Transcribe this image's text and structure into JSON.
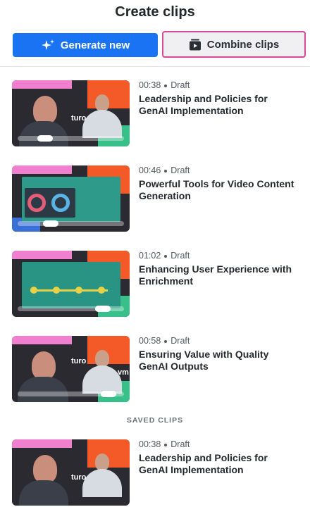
{
  "header": {
    "title": "Create clips"
  },
  "actions": {
    "generate_label": "Generate new",
    "combine_label": "Combine clips"
  },
  "clips": [
    {
      "duration": "00:38",
      "status": "Draft",
      "title": "Leadership and Policies for GenAI Implementation",
      "progress": 0.28
    },
    {
      "duration": "00:46",
      "status": "Draft",
      "title": "Powerful Tools for Video Content Generation",
      "progress": 0.35
    },
    {
      "duration": "01:02",
      "status": "Draft",
      "title": "Enhancing User Experience with Enrichment",
      "progress": 0.85
    },
    {
      "duration": "00:58",
      "status": "Draft",
      "title": "Ensuring Value with Quality GenAI Outputs",
      "progress": 0.88
    }
  ],
  "saved_section": {
    "label": "SAVED CLIPS"
  },
  "saved_clips": [
    {
      "duration": "00:38",
      "status": "Draft",
      "title": "Leadership and Policies for GenAI Implementation"
    }
  ],
  "thumb_logos": {
    "brand_a": "turo",
    "brand_b": "vm"
  },
  "colors": {
    "primary": "#1a73f2",
    "highlight_border": "#d9479a"
  }
}
